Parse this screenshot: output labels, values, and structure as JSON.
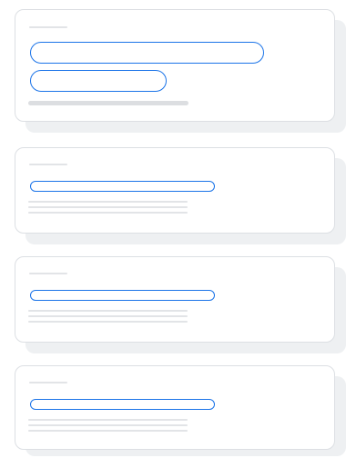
{
  "theme": {
    "accent": "#1a73e8",
    "placeholder_line": "#e2e4e7",
    "card_border": "#dcdfe3",
    "card_shadow": "#eef0f2"
  },
  "cards": [
    {
      "kind": "skeleton-card-two-buttons",
      "buttons": 2,
      "detail_lines": 1
    },
    {
      "kind": "skeleton-card-one-button",
      "buttons": 1,
      "detail_lines": 3
    },
    {
      "kind": "skeleton-card-one-button",
      "buttons": 1,
      "detail_lines": 3
    },
    {
      "kind": "skeleton-card-one-button",
      "buttons": 1,
      "detail_lines": 3
    }
  ]
}
